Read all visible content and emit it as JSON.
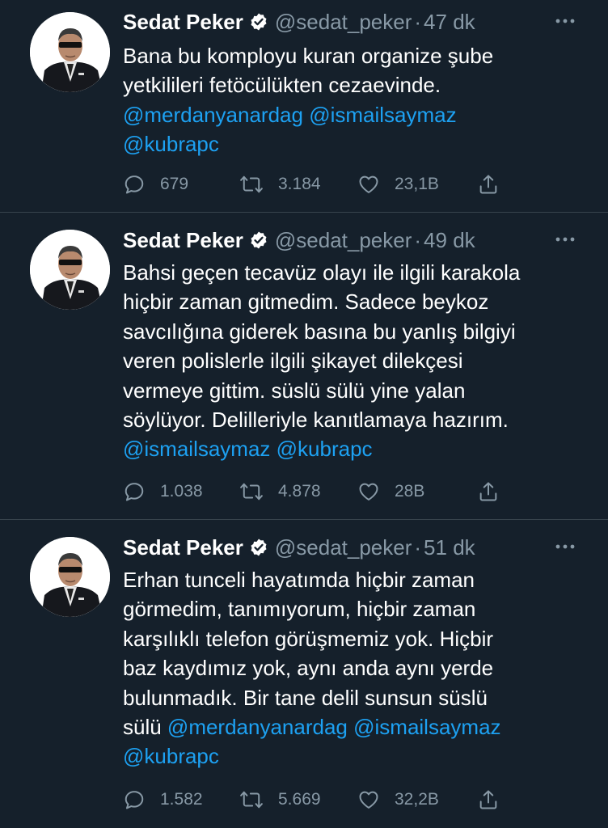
{
  "tweets": [
    {
      "name": "Sedat Peker",
      "handle": "@sedat_peker",
      "separator": "·",
      "time": "47 dk",
      "lines": [
        [
          {
            "text": "Bana bu komployu kuran organize şube",
            "mention": false
          }
        ],
        [
          {
            "text": "yetkilileri fetöcülükten cezaevinde.",
            "mention": false
          }
        ],
        [
          {
            "text": "@merdanyanardag @ismailsaymaz",
            "mention": true
          }
        ],
        [
          {
            "text": "@kubrapc",
            "mention": true
          }
        ]
      ],
      "replies": "679",
      "retweets": "3.184",
      "likes": "23,1B"
    },
    {
      "name": "Sedat Peker",
      "handle": "@sedat_peker",
      "separator": "·",
      "time": "49 dk",
      "lines": [
        [
          {
            "text": "Bahsi geçen tecavüz olayı ile ilgili karakola",
            "mention": false
          }
        ],
        [
          {
            "text": "hiçbir zaman gitmedim. Sadece beykoz",
            "mention": false
          }
        ],
        [
          {
            "text": "savcılığına giderek basına bu yanlış bilgiyi",
            "mention": false
          }
        ],
        [
          {
            "text": "veren polislerle ilgili şikayet dilekçesi",
            "mention": false
          }
        ],
        [
          {
            "text": "vermeye gittim. süslü sülü yine yalan",
            "mention": false
          }
        ],
        [
          {
            "text": "söylüyor. Delilleriyle kanıtlamaya hazırım.",
            "mention": false
          }
        ],
        [
          {
            "text": "@ismailsaymaz  @kubrapc",
            "mention": true
          }
        ]
      ],
      "replies": "1.038",
      "retweets": "4.878",
      "likes": "28B"
    },
    {
      "name": "Sedat Peker",
      "handle": "@sedat_peker",
      "separator": "·",
      "time": "51 dk",
      "lines": [
        [
          {
            "text": "Erhan tunceli hayatımda hiçbir zaman",
            "mention": false
          }
        ],
        [
          {
            "text": "görmedim, tanımıyorum, hiçbir zaman",
            "mention": false
          }
        ],
        [
          {
            "text": "karşılıklı telefon görüşmemiz yok. Hiçbir",
            "mention": false
          }
        ],
        [
          {
            "text": "baz kaydımız yok, aynı anda aynı yerde",
            "mention": false
          }
        ],
        [
          {
            "text": "bulunmadık. Bir tane delil sunsun süslü",
            "mention": false
          }
        ],
        [
          {
            "text": "sülü ",
            "mention": false
          },
          {
            "text": "@merdanyanardag @ismailsaymaz",
            "mention": true
          }
        ],
        [
          {
            "text": "@kubrapc",
            "mention": true
          }
        ]
      ],
      "replies": "1.582",
      "retweets": "5.669",
      "likes": "32,2B"
    }
  ],
  "icons": {
    "verified": "verified-badge-icon",
    "more": "more-options-icon",
    "reply": "reply-icon",
    "retweet": "retweet-icon",
    "like": "like-heart-icon",
    "share": "share-icon"
  },
  "colors": {
    "background": "#15202b",
    "text": "#ffffff",
    "muted": "#8899a6",
    "mention": "#1da1f2",
    "divider": "#38444d"
  }
}
